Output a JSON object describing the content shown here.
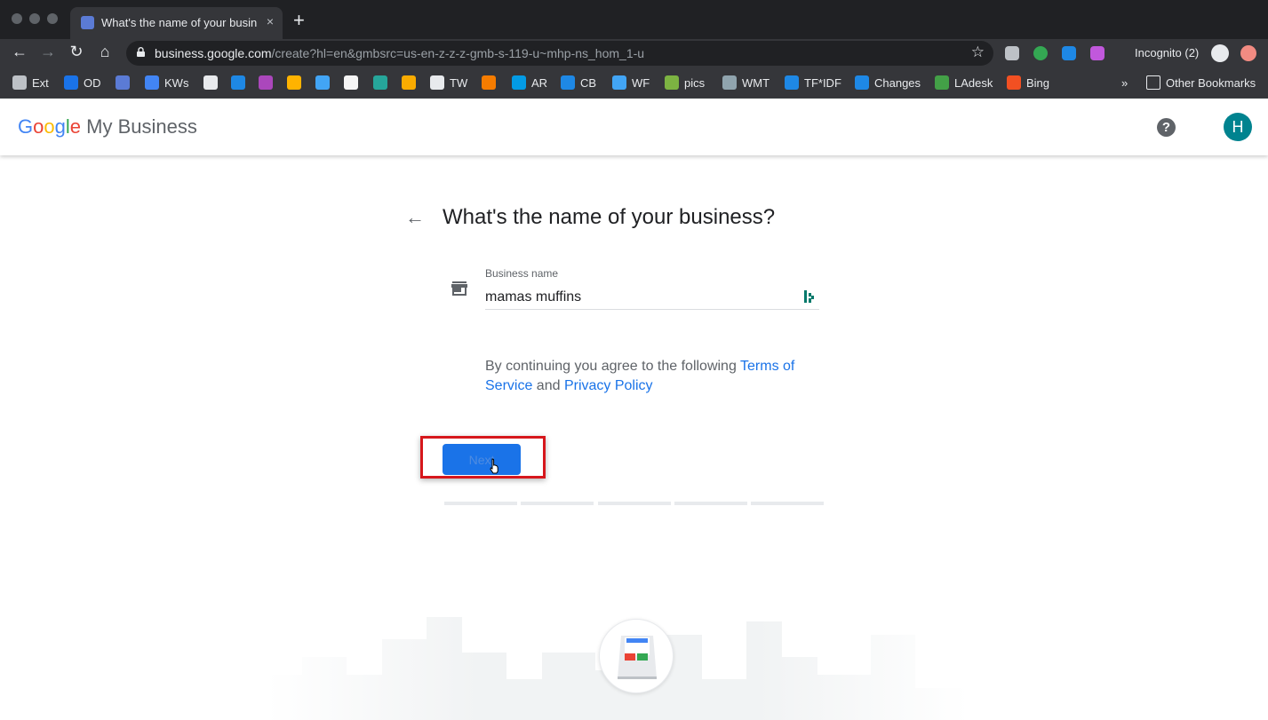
{
  "browser": {
    "tab_title": "What's the name of your business?",
    "tab_close": "×",
    "new_tab": "+",
    "url_host": "business.google.com",
    "url_path": "/create?hl=en&gmbsrc=us-en-z-z-z-gmb-s-119-u~mhp-ns_hom_1-u",
    "incognito_label": "Incognito (2)"
  },
  "bookmarks": [
    {
      "label": "Ext",
      "color": "#bdc1c6"
    },
    {
      "label": "OD",
      "color": "#1a73e8"
    },
    {
      "label": "",
      "color": "#5b7bd5"
    },
    {
      "label": "KWs",
      "color": "#4285f4"
    },
    {
      "label": "",
      "color": "#e8eaed"
    },
    {
      "label": "",
      "color": "#1e88e5"
    },
    {
      "label": "",
      "color": "#ab47bc"
    },
    {
      "label": "",
      "color": "#ffb300"
    },
    {
      "label": "",
      "color": "#42a5f5"
    },
    {
      "label": "",
      "color": "#f5f5f5"
    },
    {
      "label": "",
      "color": "#26a69a"
    },
    {
      "label": "",
      "color": "#f9ab00"
    },
    {
      "label": "TW",
      "color": "#e8eaed"
    },
    {
      "label": "",
      "color": "#f57c00"
    },
    {
      "label": "AR",
      "color": "#039be5"
    },
    {
      "label": "CB",
      "color": "#1e88e5"
    },
    {
      "label": "WF",
      "color": "#42a5f5"
    },
    {
      "label": "pics",
      "color": "#7cb342"
    },
    {
      "label": "WMT",
      "color": "#90a4ae"
    },
    {
      "label": "TF*IDF",
      "color": "#1e88e5"
    },
    {
      "label": "Changes",
      "color": "#1e88e5"
    },
    {
      "label": "LAdesk",
      "color": "#43a047"
    },
    {
      "label": "Bing",
      "color": "#f25022"
    }
  ],
  "bookmarks_overflow": "»",
  "other_bookmarks": "Other Bookmarks",
  "app": {
    "logo_google": "Google",
    "logo_rest": " My Business",
    "help": "?",
    "avatar_initial": "H"
  },
  "page": {
    "heading": "What's the name of your business?",
    "back": "←",
    "field_label": "Business name",
    "field_value": "mamas muffins",
    "terms_prefix": "By continuing you agree to the following ",
    "terms_link": "Terms of Service",
    "terms_and": " and ",
    "privacy_link": "Privacy Policy",
    "next_label": "Next",
    "progress_steps": 5,
    "progress_current": 1
  },
  "colors": {
    "accent": "#1a73e8",
    "highlight": "#d6171c",
    "avatar": "#00838f"
  }
}
